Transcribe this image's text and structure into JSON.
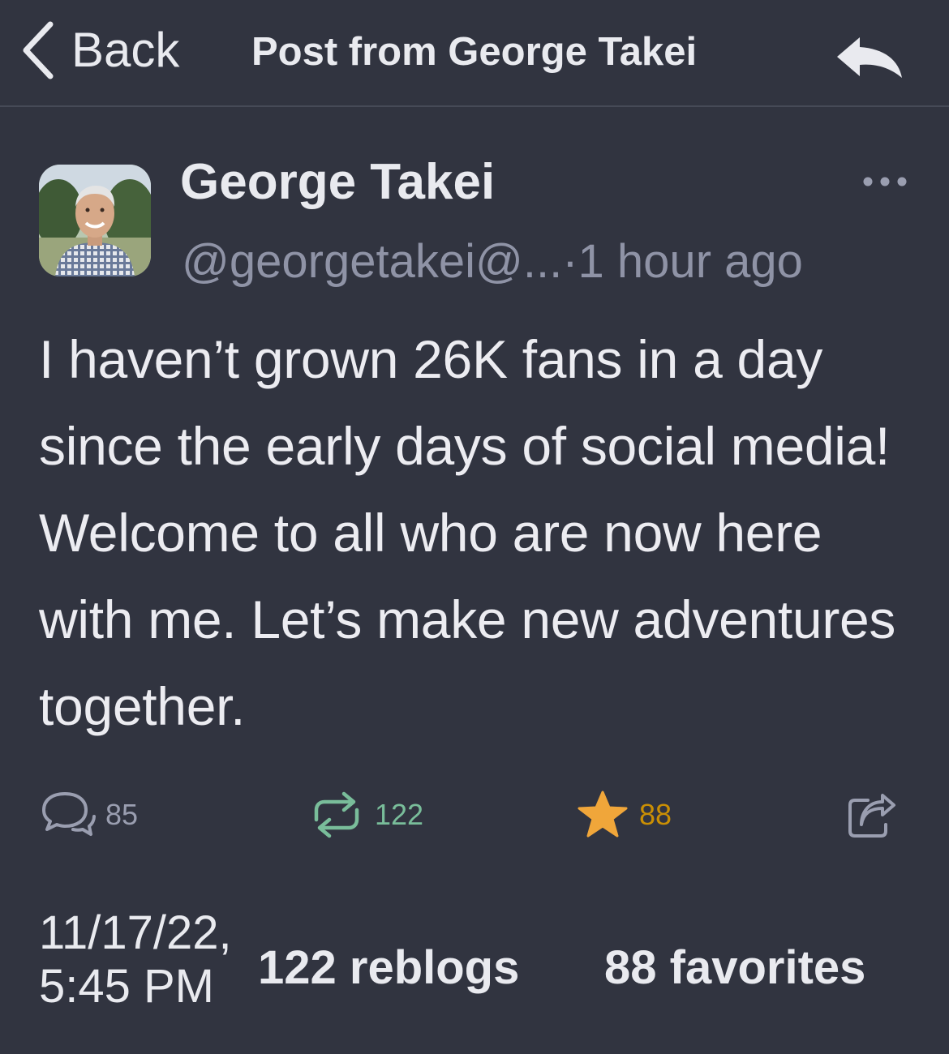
{
  "header": {
    "back_label": "Back",
    "title": "Post from George Takei",
    "back_icon": "chevron-left-icon",
    "reply_icon": "reply-icon"
  },
  "post": {
    "author_name": "George Takei",
    "handle": "@georgetakei@...",
    "separator": " · ",
    "time_ago": "1 hour ago",
    "text": "I haven’t grown 26K fans in a day since the early days of social media! Welcome to all who are now here with me. Let’s make new adventures together.",
    "more_icon": "ellipsis-icon"
  },
  "actions": {
    "replies": "85",
    "reblogs": "122",
    "favorites": "88",
    "icons": [
      "reply-bubble-icon",
      "boost-icon",
      "star-icon",
      "share-icon"
    ],
    "colors": {
      "reply": "#9a9eb0",
      "boost": "#79bd9a",
      "favorite": "#f0a63a"
    }
  },
  "footer": {
    "date_line1": "11/17/22,",
    "date_line2": "5:45 PM",
    "reblogs_label": "122 reblogs",
    "favorites_label": "88 favorites"
  },
  "theme": {
    "background": "#313440",
    "muted": "#8f93a6"
  }
}
